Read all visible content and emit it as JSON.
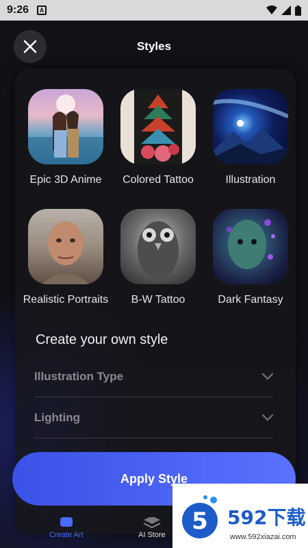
{
  "status_bar": {
    "time": "9:26",
    "badge": "A",
    "icons": [
      "wifi-icon",
      "signal-icon",
      "battery-icon"
    ]
  },
  "header": {
    "title": "Styles",
    "close_icon": "close-icon"
  },
  "styles": [
    {
      "label": "Epic 3D Anime",
      "thumb": "anime-couple"
    },
    {
      "label": "Colored Tattoo",
      "thumb": "pagoda-tattoo"
    },
    {
      "label": "Illustration",
      "thumb": "galaxy-mountains"
    },
    {
      "label": "Realistic Portraits",
      "thumb": "old-man-portrait"
    },
    {
      "label": "B-W Tattoo",
      "thumb": "owl-tattoo"
    },
    {
      "label": "Dark Fantasy",
      "thumb": "fantasy-face"
    }
  ],
  "custom": {
    "title": "Create your own style",
    "fields": [
      {
        "label": "Illustration Type"
      },
      {
        "label": "Lighting"
      }
    ]
  },
  "apply": {
    "label": "Apply Style"
  },
  "nav": {
    "create": "Create Art",
    "store": "AI Store"
  },
  "watermark": {
    "brand": "592下载",
    "url": "www.592xiazai.com"
  },
  "colors": {
    "accent": "#4a6bff",
    "background": "#121216",
    "button": "#4a62f2"
  }
}
